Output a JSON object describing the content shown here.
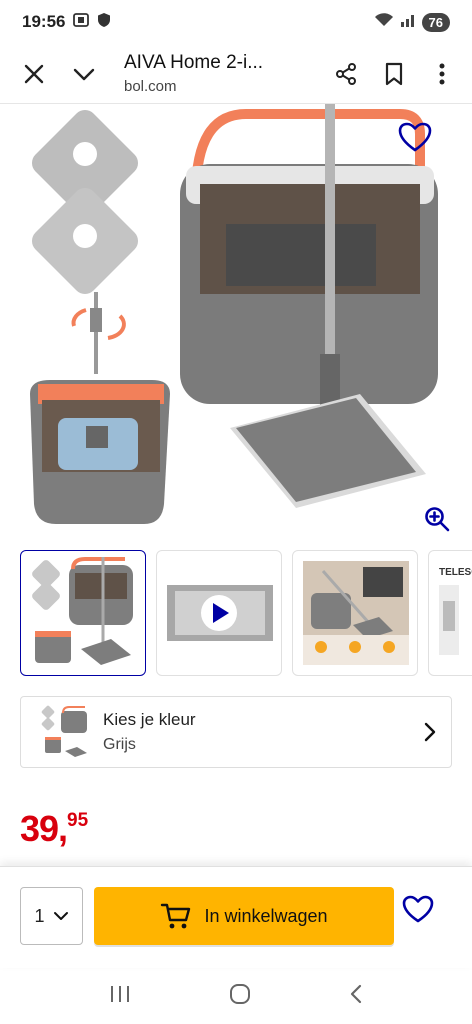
{
  "status_bar": {
    "time": "19:56",
    "battery": "76",
    "icons": [
      "screenshot-icon",
      "shield-icon",
      "wifi-icon",
      "signal-icon"
    ]
  },
  "top_bar": {
    "title": "AIVA Home 2-i...",
    "domain": "bol.com",
    "icons": [
      "close-icon",
      "chevron-down-icon",
      "share-icon",
      "bookmark-icon",
      "more-vert-icon"
    ]
  },
  "product": {
    "thumbnails": [
      "mop-set-thumbnail",
      "video-thumbnail",
      "lifestyle-thumbnail",
      "telescope-thumbnail"
    ],
    "thumb_partial_text": "TELESCO",
    "color_label": "Kies je kleur",
    "color_value": "Grijs",
    "price_int": "39,",
    "price_dec": "95"
  },
  "actions": {
    "quantity": "1",
    "cart_label": "In winkelwagen"
  },
  "colors": {
    "accent": "#ffb400",
    "price": "#d8000d",
    "brand_blue": "#0000a4",
    "bucket_orange": "#f2805a"
  }
}
